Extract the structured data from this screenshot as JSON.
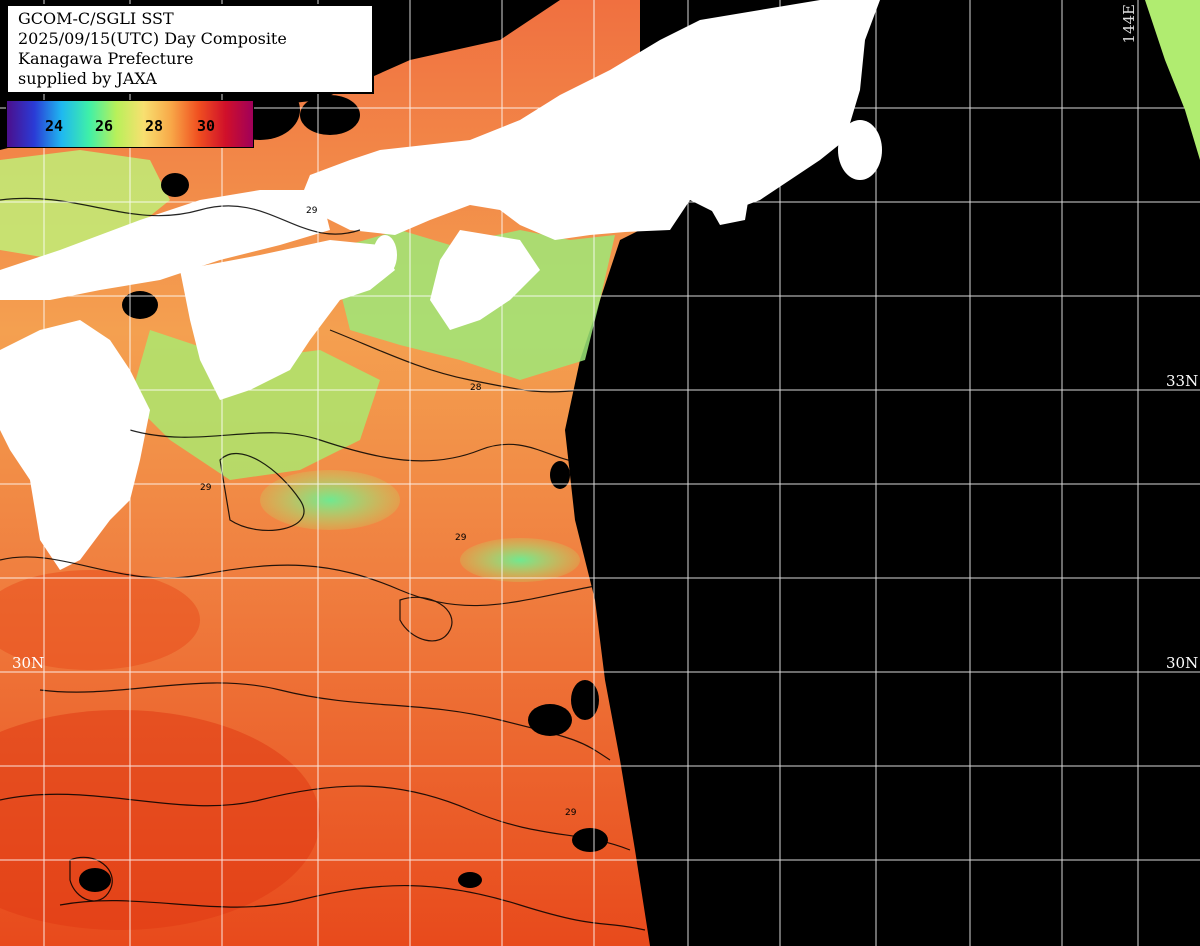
{
  "title": {
    "line1": "GCOM-C/SGLI SST",
    "line2": "2025/09/15(UTC) Day Composite",
    "line3": "Kanagawa Prefecture",
    "line4": "supplied by JAXA"
  },
  "colorbar": {
    "ticks": [
      "24",
      "26",
      "28",
      "30"
    ],
    "colors": [
      "#4b0f8c",
      "#2a3bd6",
      "#1fb8f0",
      "#3ff0a8",
      "#b8f05a",
      "#f8e070",
      "#f8a848",
      "#f05020",
      "#d0102a",
      "#a0005a"
    ]
  },
  "grid_labels": {
    "lat_33": "33N",
    "lat_30_right": "30N",
    "lat_30_left": "30N",
    "lon_144": "144E"
  },
  "colors": {
    "land": "#ffffff",
    "no_data": "#000000",
    "grid": "#ffffff",
    "contour": "#000000",
    "warm_sst": "#e8501e",
    "mid_sst": "#f4a050",
    "cool_sst": "#90e870"
  },
  "contour_labels": [
    "29",
    "28",
    "29",
    "29",
    "29"
  ]
}
